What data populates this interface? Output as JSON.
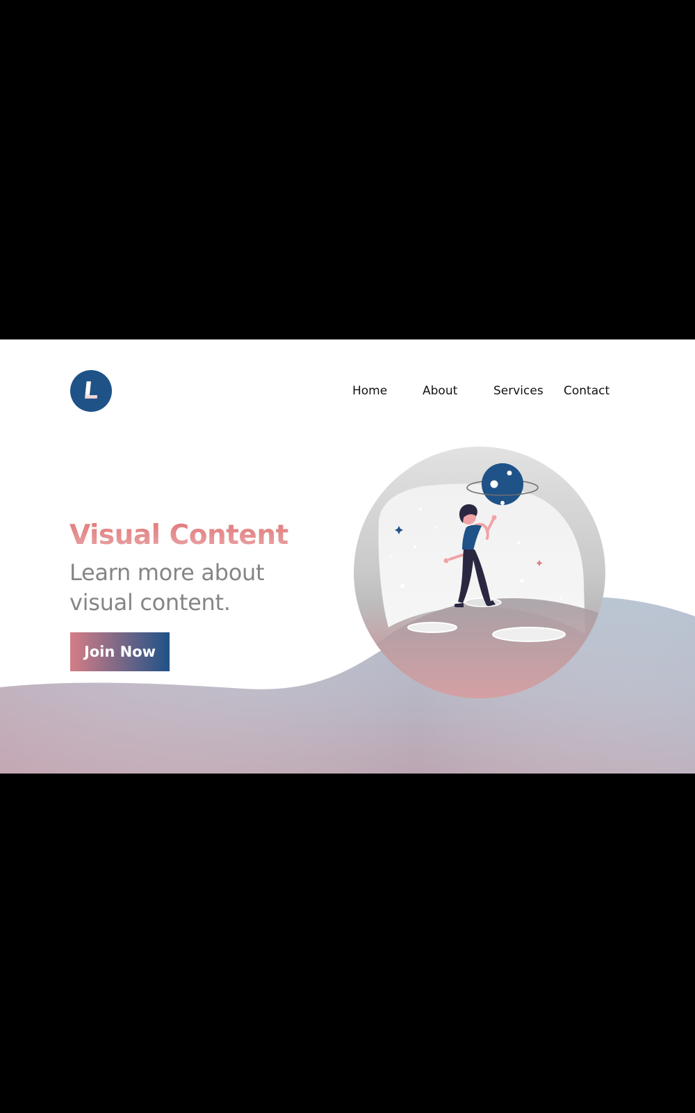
{
  "brand": {
    "logo_letter": "L",
    "colors": {
      "primary_blue": "#1f5287",
      "accent_pink": "#e07b7d",
      "wave_top": "#b7c3d2",
      "wave_bottom": "#b9a7b2",
      "background": "#ffffff"
    }
  },
  "nav": {
    "items": [
      "Home",
      "About",
      "Services",
      "Contact"
    ]
  },
  "hero": {
    "title": "Visual Content",
    "subtitle": "Learn more about visual content.",
    "cta_label": "Join Now"
  },
  "illustration": {
    "icons": [
      "globe-bubble",
      "planet-icon",
      "person-figure",
      "sparkle-stars",
      "crater-ellipses"
    ]
  }
}
